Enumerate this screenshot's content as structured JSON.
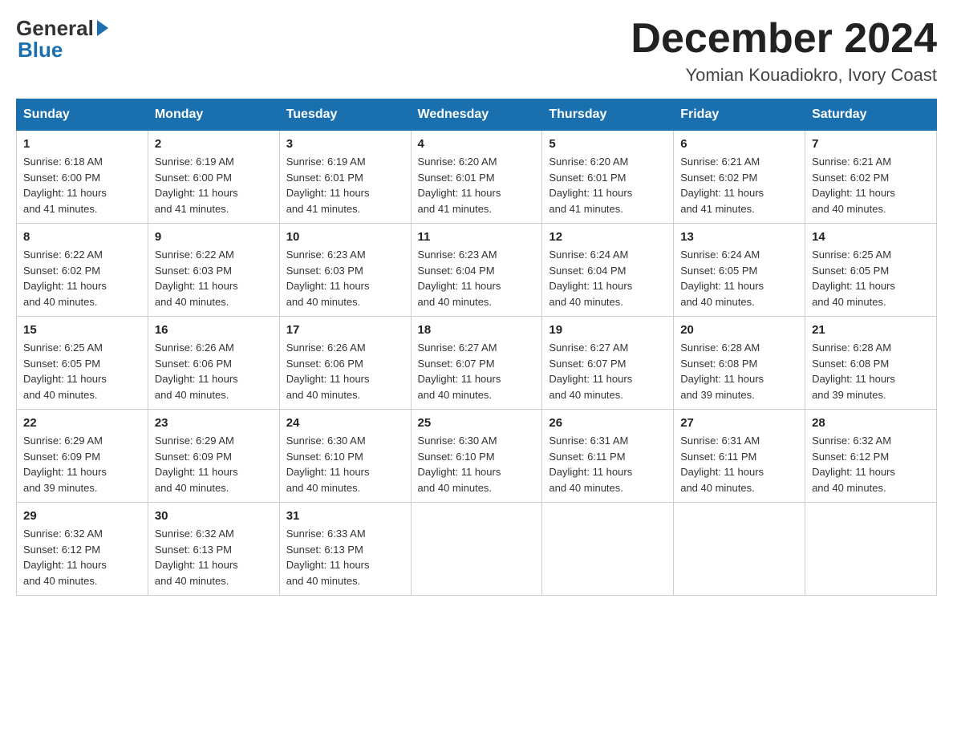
{
  "logo": {
    "general": "General",
    "blue": "Blue"
  },
  "title": {
    "month": "December 2024",
    "location": "Yomian Kouadiokro, Ivory Coast"
  },
  "headers": [
    "Sunday",
    "Monday",
    "Tuesday",
    "Wednesday",
    "Thursday",
    "Friday",
    "Saturday"
  ],
  "weeks": [
    [
      {
        "day": "1",
        "sunrise": "6:18 AM",
        "sunset": "6:00 PM",
        "daylight": "11 hours and 41 minutes."
      },
      {
        "day": "2",
        "sunrise": "6:19 AM",
        "sunset": "6:00 PM",
        "daylight": "11 hours and 41 minutes."
      },
      {
        "day": "3",
        "sunrise": "6:19 AM",
        "sunset": "6:01 PM",
        "daylight": "11 hours and 41 minutes."
      },
      {
        "day": "4",
        "sunrise": "6:20 AM",
        "sunset": "6:01 PM",
        "daylight": "11 hours and 41 minutes."
      },
      {
        "day": "5",
        "sunrise": "6:20 AM",
        "sunset": "6:01 PM",
        "daylight": "11 hours and 41 minutes."
      },
      {
        "day": "6",
        "sunrise": "6:21 AM",
        "sunset": "6:02 PM",
        "daylight": "11 hours and 41 minutes."
      },
      {
        "day": "7",
        "sunrise": "6:21 AM",
        "sunset": "6:02 PM",
        "daylight": "11 hours and 40 minutes."
      }
    ],
    [
      {
        "day": "8",
        "sunrise": "6:22 AM",
        "sunset": "6:02 PM",
        "daylight": "11 hours and 40 minutes."
      },
      {
        "day": "9",
        "sunrise": "6:22 AM",
        "sunset": "6:03 PM",
        "daylight": "11 hours and 40 minutes."
      },
      {
        "day": "10",
        "sunrise": "6:23 AM",
        "sunset": "6:03 PM",
        "daylight": "11 hours and 40 minutes."
      },
      {
        "day": "11",
        "sunrise": "6:23 AM",
        "sunset": "6:04 PM",
        "daylight": "11 hours and 40 minutes."
      },
      {
        "day": "12",
        "sunrise": "6:24 AM",
        "sunset": "6:04 PM",
        "daylight": "11 hours and 40 minutes."
      },
      {
        "day": "13",
        "sunrise": "6:24 AM",
        "sunset": "6:05 PM",
        "daylight": "11 hours and 40 minutes."
      },
      {
        "day": "14",
        "sunrise": "6:25 AM",
        "sunset": "6:05 PM",
        "daylight": "11 hours and 40 minutes."
      }
    ],
    [
      {
        "day": "15",
        "sunrise": "6:25 AM",
        "sunset": "6:05 PM",
        "daylight": "11 hours and 40 minutes."
      },
      {
        "day": "16",
        "sunrise": "6:26 AM",
        "sunset": "6:06 PM",
        "daylight": "11 hours and 40 minutes."
      },
      {
        "day": "17",
        "sunrise": "6:26 AM",
        "sunset": "6:06 PM",
        "daylight": "11 hours and 40 minutes."
      },
      {
        "day": "18",
        "sunrise": "6:27 AM",
        "sunset": "6:07 PM",
        "daylight": "11 hours and 40 minutes."
      },
      {
        "day": "19",
        "sunrise": "6:27 AM",
        "sunset": "6:07 PM",
        "daylight": "11 hours and 40 minutes."
      },
      {
        "day": "20",
        "sunrise": "6:28 AM",
        "sunset": "6:08 PM",
        "daylight": "11 hours and 39 minutes."
      },
      {
        "day": "21",
        "sunrise": "6:28 AM",
        "sunset": "6:08 PM",
        "daylight": "11 hours and 39 minutes."
      }
    ],
    [
      {
        "day": "22",
        "sunrise": "6:29 AM",
        "sunset": "6:09 PM",
        "daylight": "11 hours and 39 minutes."
      },
      {
        "day": "23",
        "sunrise": "6:29 AM",
        "sunset": "6:09 PM",
        "daylight": "11 hours and 40 minutes."
      },
      {
        "day": "24",
        "sunrise": "6:30 AM",
        "sunset": "6:10 PM",
        "daylight": "11 hours and 40 minutes."
      },
      {
        "day": "25",
        "sunrise": "6:30 AM",
        "sunset": "6:10 PM",
        "daylight": "11 hours and 40 minutes."
      },
      {
        "day": "26",
        "sunrise": "6:31 AM",
        "sunset": "6:11 PM",
        "daylight": "11 hours and 40 minutes."
      },
      {
        "day": "27",
        "sunrise": "6:31 AM",
        "sunset": "6:11 PM",
        "daylight": "11 hours and 40 minutes."
      },
      {
        "day": "28",
        "sunrise": "6:32 AM",
        "sunset": "6:12 PM",
        "daylight": "11 hours and 40 minutes."
      }
    ],
    [
      {
        "day": "29",
        "sunrise": "6:32 AM",
        "sunset": "6:12 PM",
        "daylight": "11 hours and 40 minutes."
      },
      {
        "day": "30",
        "sunrise": "6:32 AM",
        "sunset": "6:13 PM",
        "daylight": "11 hours and 40 minutes."
      },
      {
        "day": "31",
        "sunrise": "6:33 AM",
        "sunset": "6:13 PM",
        "daylight": "11 hours and 40 minutes."
      },
      null,
      null,
      null,
      null
    ]
  ],
  "labels": {
    "sunrise": "Sunrise:",
    "sunset": "Sunset:",
    "daylight": "Daylight:"
  }
}
